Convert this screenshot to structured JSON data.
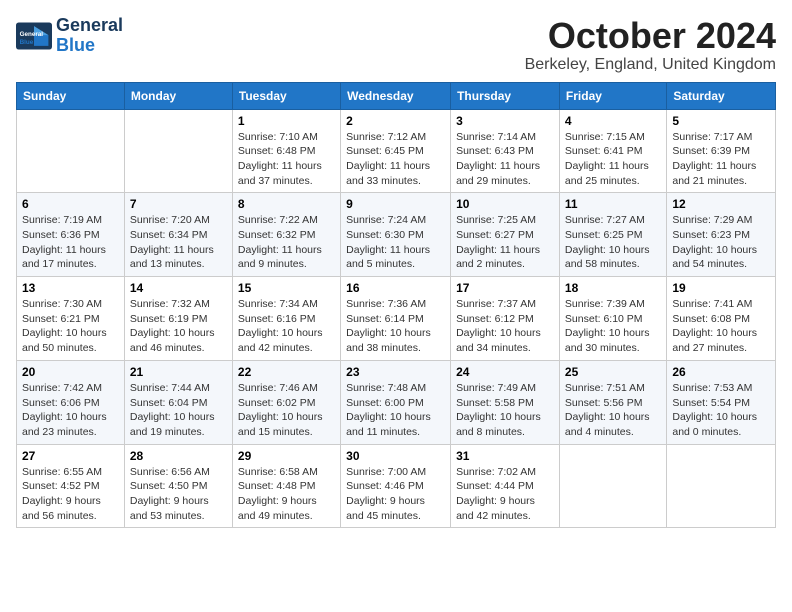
{
  "logo": {
    "line1": "General",
    "line2": "Blue"
  },
  "title": "October 2024",
  "location": "Berkeley, England, United Kingdom",
  "weekdays": [
    "Sunday",
    "Monday",
    "Tuesday",
    "Wednesday",
    "Thursday",
    "Friday",
    "Saturday"
  ],
  "weeks": [
    [
      {
        "day": "",
        "info": ""
      },
      {
        "day": "",
        "info": ""
      },
      {
        "day": "1",
        "info": "Sunrise: 7:10 AM\nSunset: 6:48 PM\nDaylight: 11 hours\nand 37 minutes."
      },
      {
        "day": "2",
        "info": "Sunrise: 7:12 AM\nSunset: 6:45 PM\nDaylight: 11 hours\nand 33 minutes."
      },
      {
        "day": "3",
        "info": "Sunrise: 7:14 AM\nSunset: 6:43 PM\nDaylight: 11 hours\nand 29 minutes."
      },
      {
        "day": "4",
        "info": "Sunrise: 7:15 AM\nSunset: 6:41 PM\nDaylight: 11 hours\nand 25 minutes."
      },
      {
        "day": "5",
        "info": "Sunrise: 7:17 AM\nSunset: 6:39 PM\nDaylight: 11 hours\nand 21 minutes."
      }
    ],
    [
      {
        "day": "6",
        "info": "Sunrise: 7:19 AM\nSunset: 6:36 PM\nDaylight: 11 hours\nand 17 minutes."
      },
      {
        "day": "7",
        "info": "Sunrise: 7:20 AM\nSunset: 6:34 PM\nDaylight: 11 hours\nand 13 minutes."
      },
      {
        "day": "8",
        "info": "Sunrise: 7:22 AM\nSunset: 6:32 PM\nDaylight: 11 hours\nand 9 minutes."
      },
      {
        "day": "9",
        "info": "Sunrise: 7:24 AM\nSunset: 6:30 PM\nDaylight: 11 hours\nand 5 minutes."
      },
      {
        "day": "10",
        "info": "Sunrise: 7:25 AM\nSunset: 6:27 PM\nDaylight: 11 hours\nand 2 minutes."
      },
      {
        "day": "11",
        "info": "Sunrise: 7:27 AM\nSunset: 6:25 PM\nDaylight: 10 hours\nand 58 minutes."
      },
      {
        "day": "12",
        "info": "Sunrise: 7:29 AM\nSunset: 6:23 PM\nDaylight: 10 hours\nand 54 minutes."
      }
    ],
    [
      {
        "day": "13",
        "info": "Sunrise: 7:30 AM\nSunset: 6:21 PM\nDaylight: 10 hours\nand 50 minutes."
      },
      {
        "day": "14",
        "info": "Sunrise: 7:32 AM\nSunset: 6:19 PM\nDaylight: 10 hours\nand 46 minutes."
      },
      {
        "day": "15",
        "info": "Sunrise: 7:34 AM\nSunset: 6:16 PM\nDaylight: 10 hours\nand 42 minutes."
      },
      {
        "day": "16",
        "info": "Sunrise: 7:36 AM\nSunset: 6:14 PM\nDaylight: 10 hours\nand 38 minutes."
      },
      {
        "day": "17",
        "info": "Sunrise: 7:37 AM\nSunset: 6:12 PM\nDaylight: 10 hours\nand 34 minutes."
      },
      {
        "day": "18",
        "info": "Sunrise: 7:39 AM\nSunset: 6:10 PM\nDaylight: 10 hours\nand 30 minutes."
      },
      {
        "day": "19",
        "info": "Sunrise: 7:41 AM\nSunset: 6:08 PM\nDaylight: 10 hours\nand 27 minutes."
      }
    ],
    [
      {
        "day": "20",
        "info": "Sunrise: 7:42 AM\nSunset: 6:06 PM\nDaylight: 10 hours\nand 23 minutes."
      },
      {
        "day": "21",
        "info": "Sunrise: 7:44 AM\nSunset: 6:04 PM\nDaylight: 10 hours\nand 19 minutes."
      },
      {
        "day": "22",
        "info": "Sunrise: 7:46 AM\nSunset: 6:02 PM\nDaylight: 10 hours\nand 15 minutes."
      },
      {
        "day": "23",
        "info": "Sunrise: 7:48 AM\nSunset: 6:00 PM\nDaylight: 10 hours\nand 11 minutes."
      },
      {
        "day": "24",
        "info": "Sunrise: 7:49 AM\nSunset: 5:58 PM\nDaylight: 10 hours\nand 8 minutes."
      },
      {
        "day": "25",
        "info": "Sunrise: 7:51 AM\nSunset: 5:56 PM\nDaylight: 10 hours\nand 4 minutes."
      },
      {
        "day": "26",
        "info": "Sunrise: 7:53 AM\nSunset: 5:54 PM\nDaylight: 10 hours\nand 0 minutes."
      }
    ],
    [
      {
        "day": "27",
        "info": "Sunrise: 6:55 AM\nSunset: 4:52 PM\nDaylight: 9 hours\nand 56 minutes."
      },
      {
        "day": "28",
        "info": "Sunrise: 6:56 AM\nSunset: 4:50 PM\nDaylight: 9 hours\nand 53 minutes."
      },
      {
        "day": "29",
        "info": "Sunrise: 6:58 AM\nSunset: 4:48 PM\nDaylight: 9 hours\nand 49 minutes."
      },
      {
        "day": "30",
        "info": "Sunrise: 7:00 AM\nSunset: 4:46 PM\nDaylight: 9 hours\nand 45 minutes."
      },
      {
        "day": "31",
        "info": "Sunrise: 7:02 AM\nSunset: 4:44 PM\nDaylight: 9 hours\nand 42 minutes."
      },
      {
        "day": "",
        "info": ""
      },
      {
        "day": "",
        "info": ""
      }
    ]
  ]
}
